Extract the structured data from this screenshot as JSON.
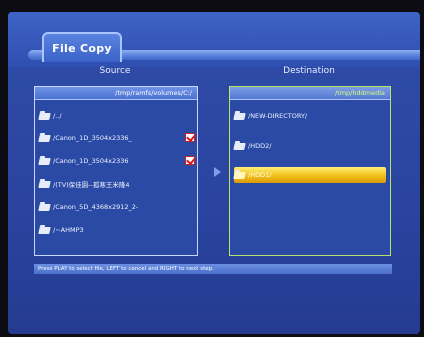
{
  "window": {
    "title": "File Copy"
  },
  "source": {
    "heading": "Source",
    "path": "/tmp/ramfs/volumes/C:/",
    "items": [
      {
        "label": "/../",
        "checked": false
      },
      {
        "label": "/Canon_1D_3504x2336_",
        "checked": true
      },
      {
        "label": "/Canon_1D_3504x2336",
        "checked": true
      },
      {
        "label": "/(TV)保佳園--孤寒王米隆4",
        "checked": false
      },
      {
        "label": "/Canon_5D_4368x2912_2-",
        "checked": false
      },
      {
        "label": "/~AHMP3",
        "checked": false
      }
    ]
  },
  "destination": {
    "heading": "Destination",
    "path": "/tmp/hddmedia",
    "items": [
      {
        "label": "/NEW-DIRECTORY/",
        "selected": false
      },
      {
        "label": "/HDD2/",
        "selected": false
      },
      {
        "label": "/HDD1/",
        "selected": true
      }
    ]
  },
  "status": {
    "hint": "Press PLAY to select file, LEFT to cancel and RIGHT to next step."
  },
  "colors": {
    "background": "#2a44a0",
    "highlight": "#f0c018",
    "check": "#e01818",
    "dest_border": "#b7e36a"
  }
}
